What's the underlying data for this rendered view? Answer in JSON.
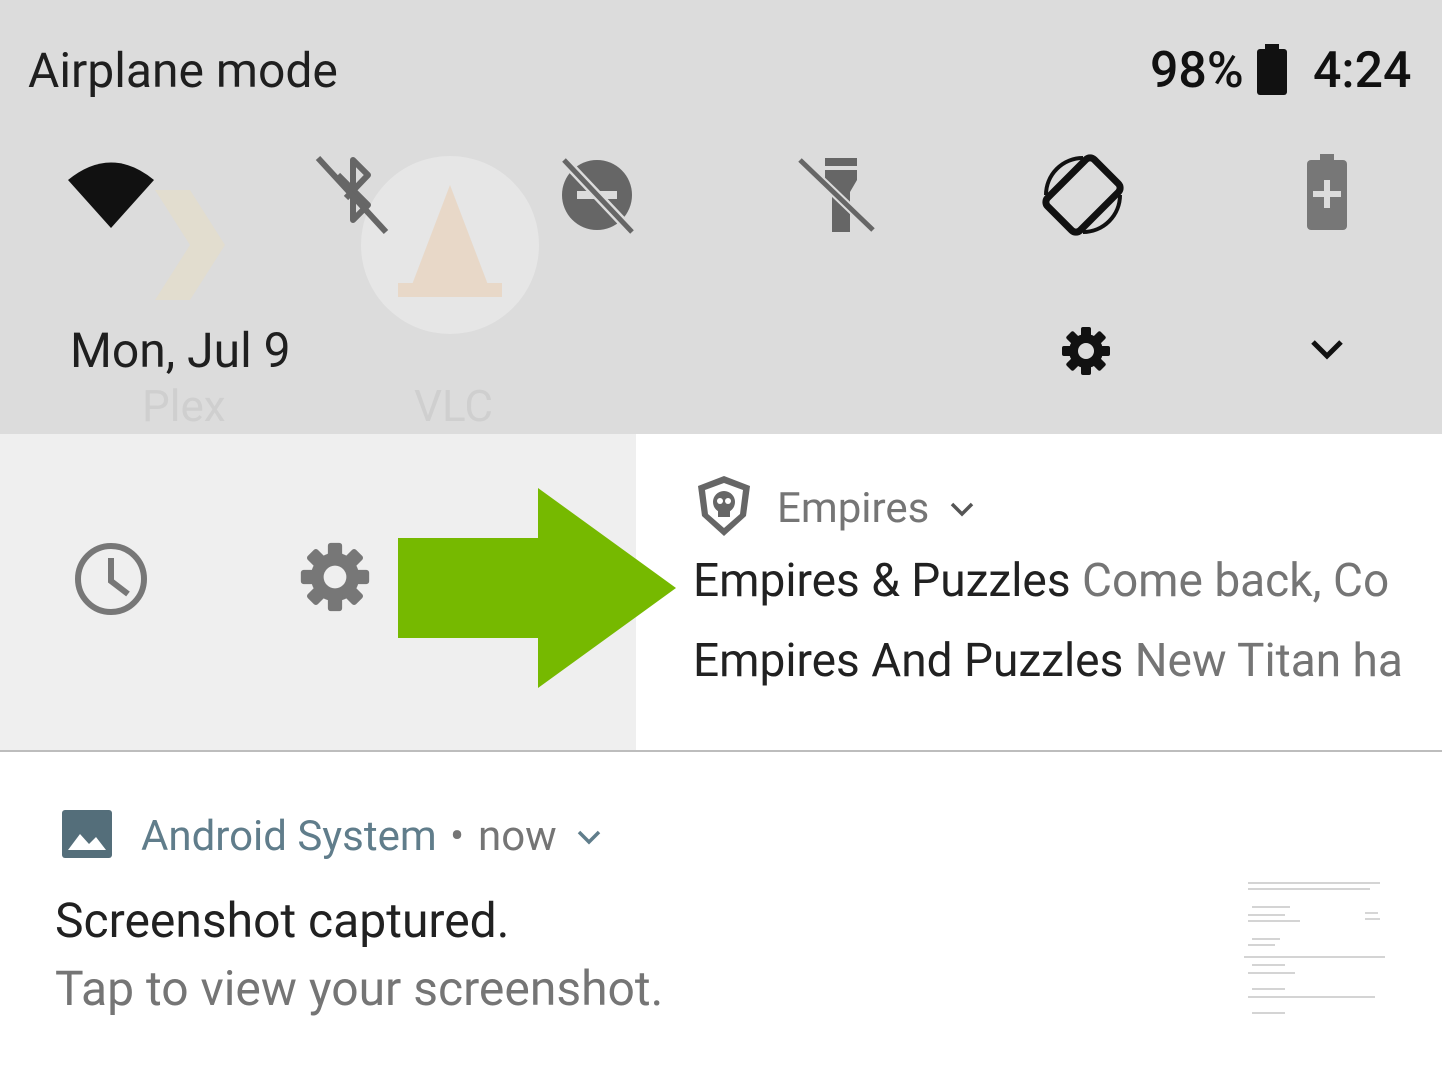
{
  "status_bar": {
    "title": "Airplane mode",
    "battery_percent": "98%",
    "clock": "4:24"
  },
  "quick_settings": {
    "date": "Mon, Jul 9",
    "background_apps": [
      "Plex",
      "VLC"
    ],
    "tiles": [
      {
        "name": "wifi",
        "icon": "wifi-icon"
      },
      {
        "name": "bluetooth off",
        "icon": "bluetooth-off-icon"
      },
      {
        "name": "do not disturb off",
        "icon": "dnd-off-icon"
      },
      {
        "name": "flashlight off",
        "icon": "flashlight-off-icon"
      },
      {
        "name": "auto-rotate",
        "icon": "rotate-icon"
      },
      {
        "name": "battery saver",
        "icon": "battery-saver-icon"
      }
    ]
  },
  "swipe_actions": {
    "snooze_icon": "clock-icon",
    "settings_icon": "gear-icon",
    "arrow_color": "#76b900"
  },
  "empires_notification": {
    "app_name": "Empires",
    "lines": [
      {
        "title": "Empires & Puzzles",
        "body": "Come back, Co"
      },
      {
        "title": "Empires And Puzzles",
        "body": "New Titan ha"
      }
    ]
  },
  "android_notification": {
    "app_name": "Android System",
    "separator": "•",
    "time": "now",
    "title": "Screenshot captured.",
    "body": "Tap to view your screenshot."
  }
}
